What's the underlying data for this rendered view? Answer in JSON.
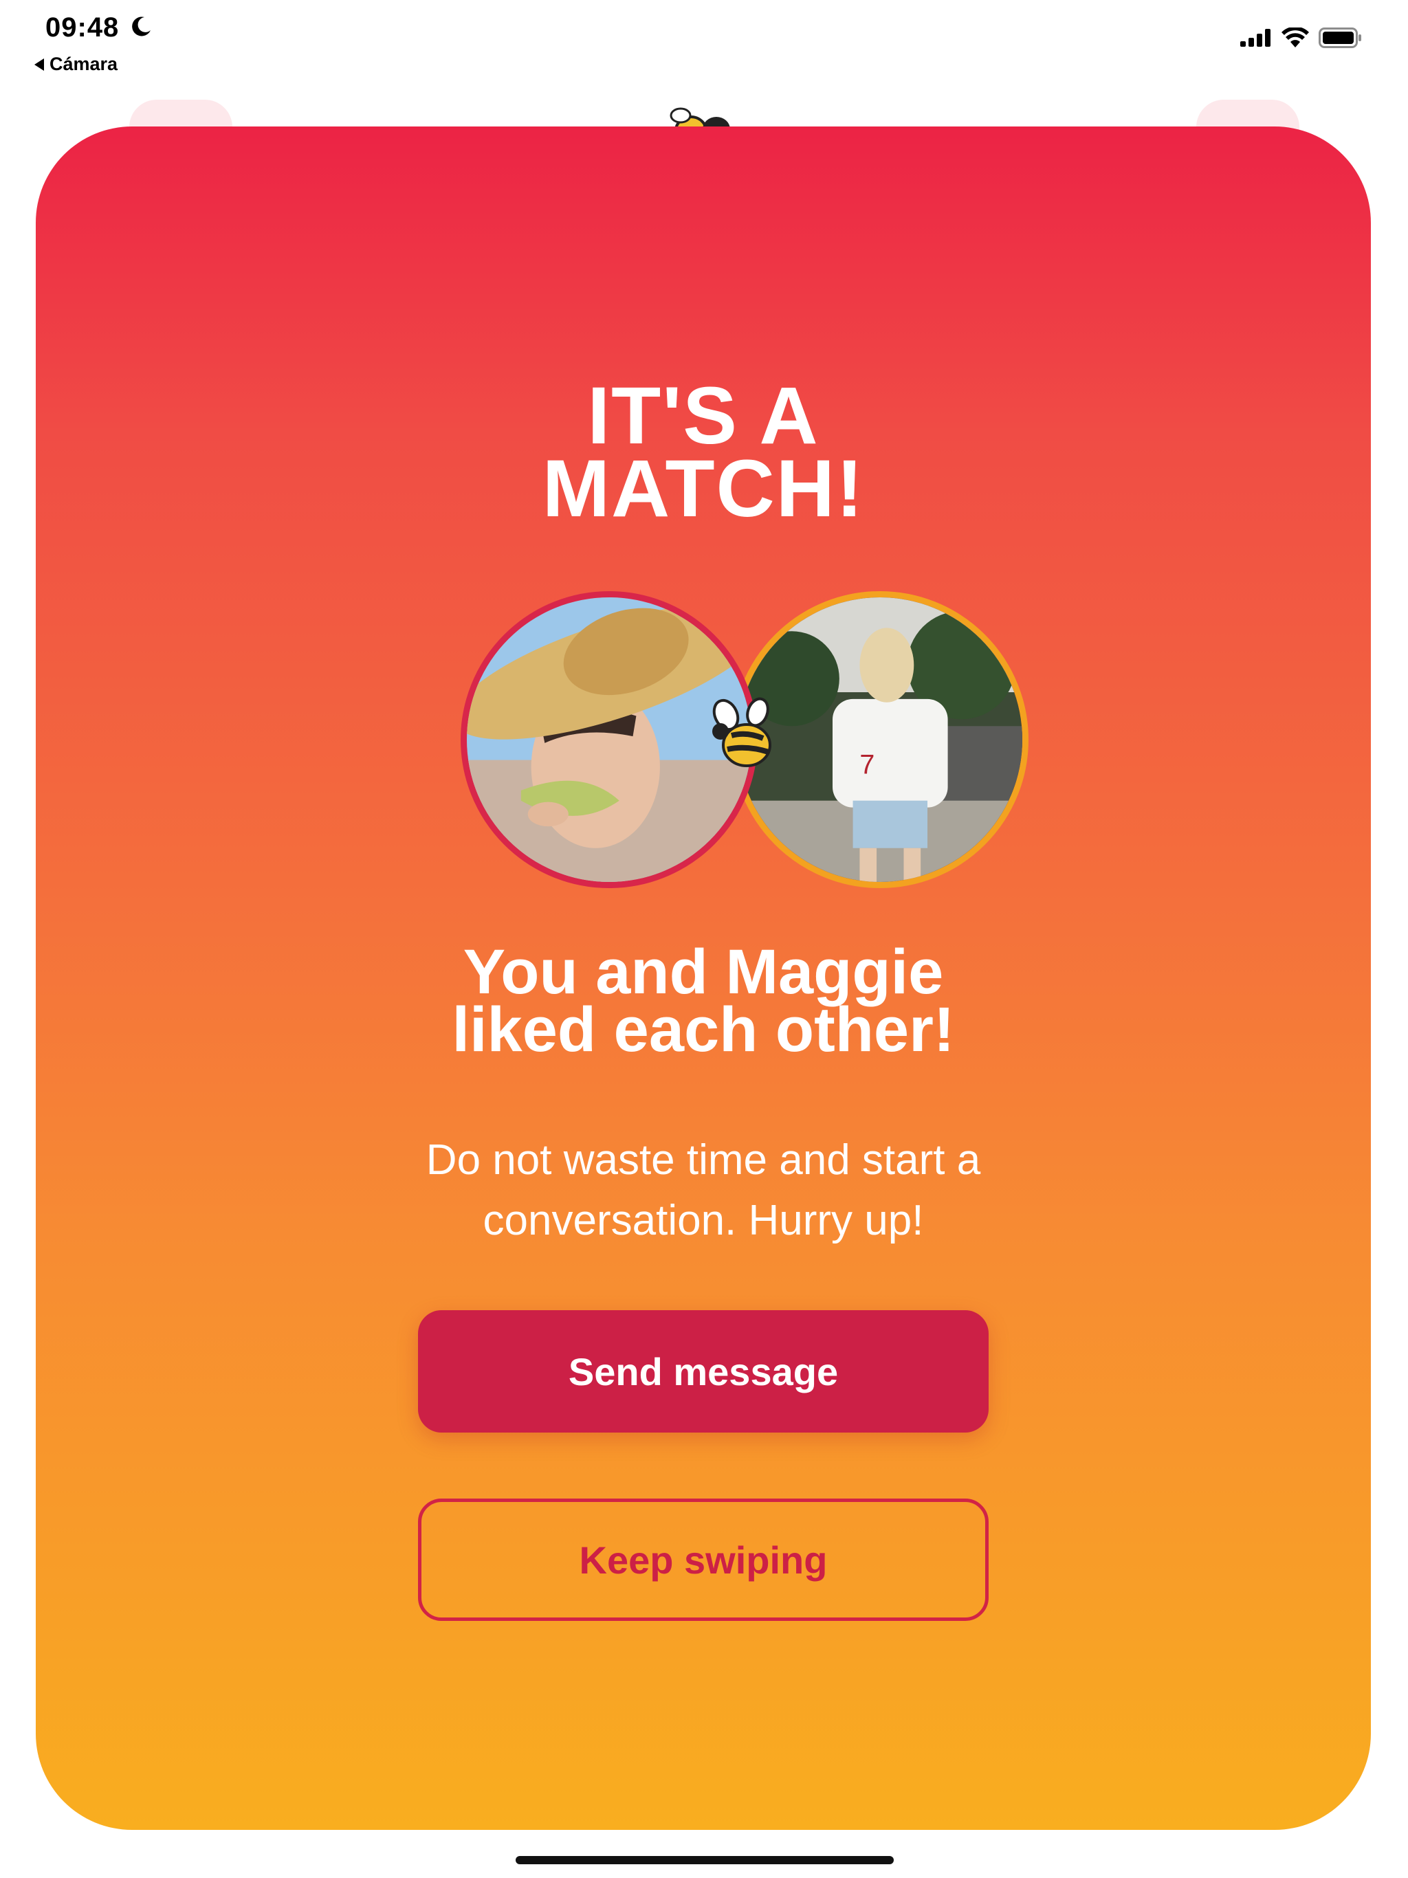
{
  "status_bar": {
    "time": "09:48",
    "back_app": "Cámara"
  },
  "match": {
    "title_line1": "IT'S A",
    "title_line2": "MATCH!",
    "subtitle_line1": "You and Maggie",
    "subtitle_line2": "liked each other!",
    "body_line1": "Do not waste time and start a",
    "body_line2": "conversation. Hurry up!",
    "send_message_label": "Send message",
    "keep_swiping_label": "Keep swiping"
  },
  "colors": {
    "gradient_top": "#ec2345",
    "gradient_bottom": "#f9ae1f",
    "primary_button": "#cc2046",
    "left_avatar_ring": "#d8264a",
    "right_avatar_ring": "#f3a220"
  },
  "icons": [
    "moon-icon",
    "back-arrow-icon",
    "signal-icon",
    "wifi-icon",
    "battery-icon",
    "bee-icon"
  ]
}
